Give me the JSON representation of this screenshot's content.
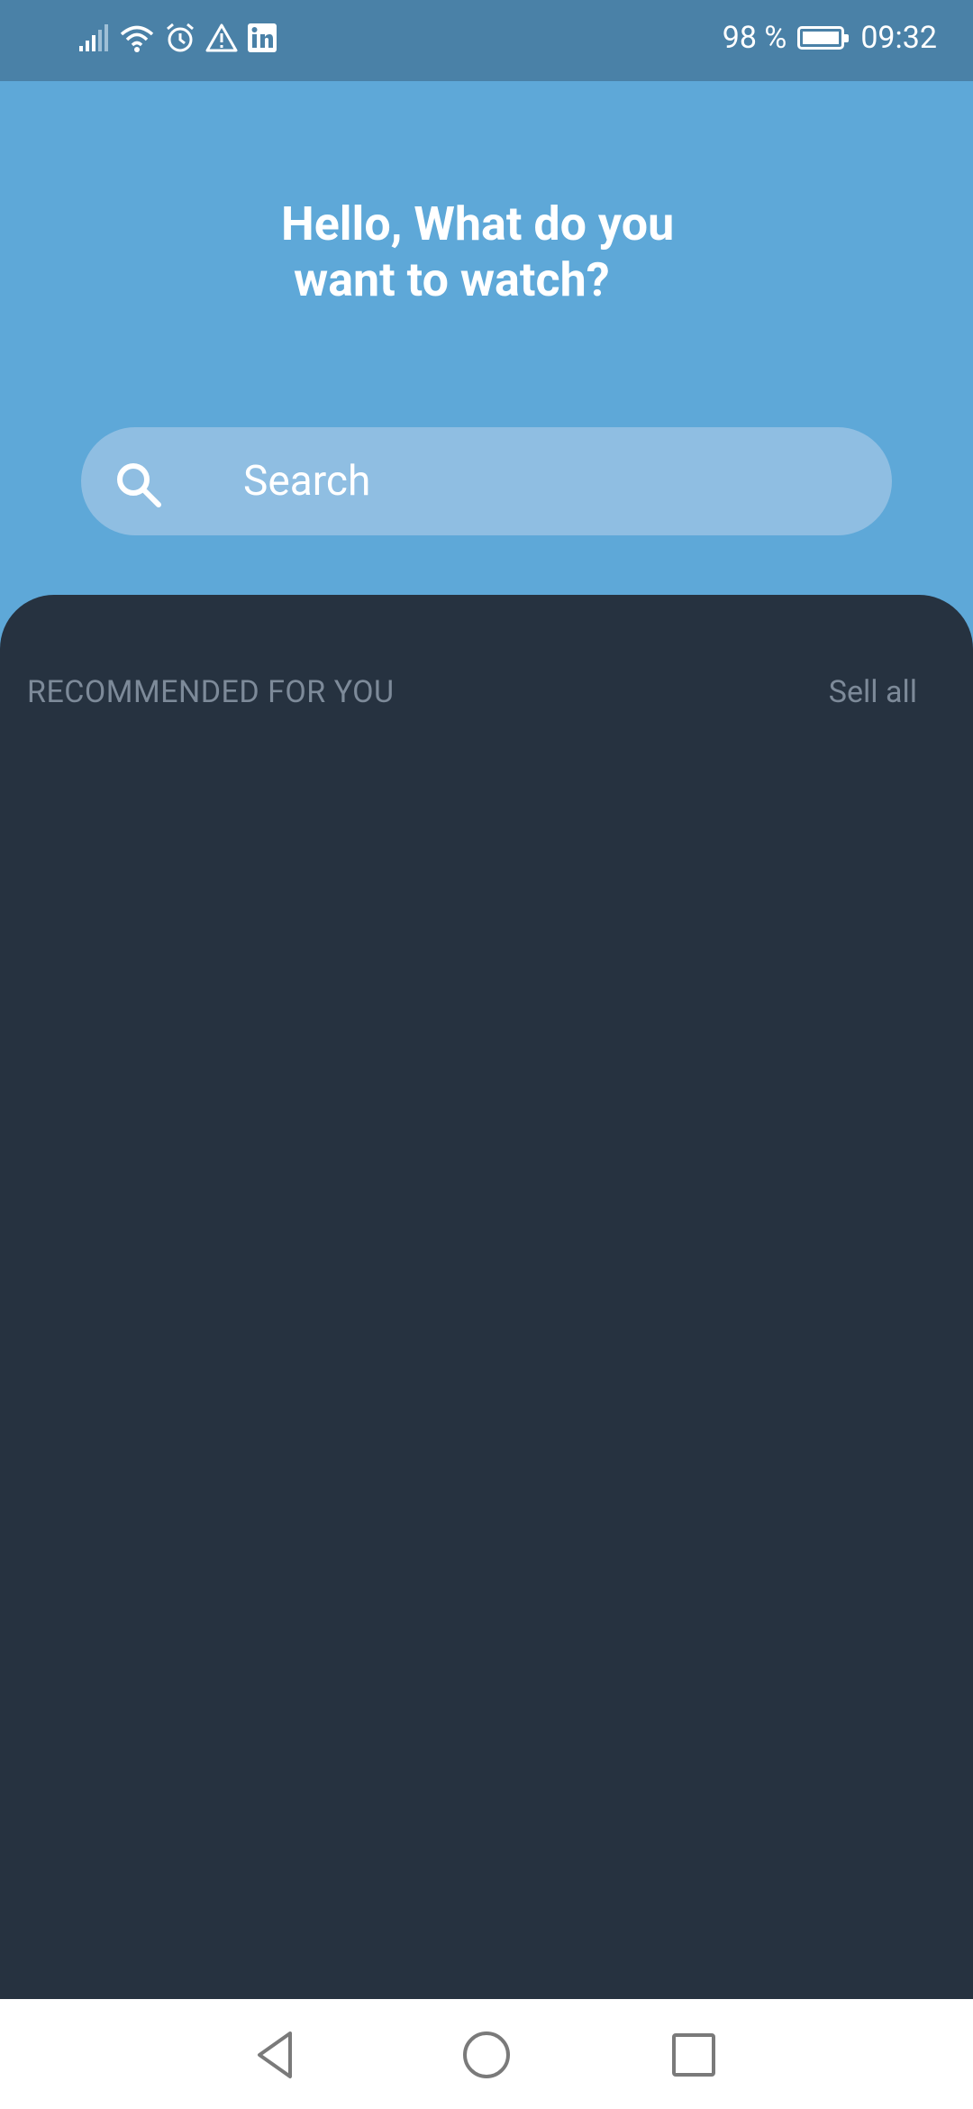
{
  "status_bar": {
    "battery": "98 %",
    "time": "09:32",
    "icons": [
      "signal-icon",
      "wifi-icon",
      "alarm-icon",
      "warning-icon",
      "linkedin-icon",
      "battery-icon"
    ]
  },
  "header": {
    "greeting_line1": "Hello, What do you",
    "greeting_line2": "want to watch?"
  },
  "search": {
    "placeholder": "Search",
    "icon": "search-icon"
  },
  "section": {
    "title": "RECOMMENDED FOR YOU",
    "link": "Sell all"
  },
  "navigation": {
    "back": "back-icon",
    "home": "home-icon",
    "recents": "recents-icon"
  },
  "colors": {
    "header_bg": "#5ea8d8",
    "status_bg": "#4a81a7",
    "search_bg": "#8fbee2",
    "content_bg": "#263240",
    "muted_text": "#7d8a99"
  }
}
